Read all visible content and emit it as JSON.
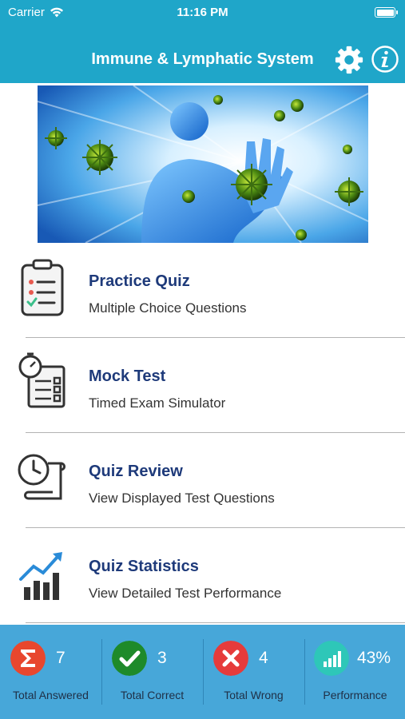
{
  "status_bar": {
    "carrier": "Carrier",
    "time": "11:16 PM"
  },
  "header": {
    "title": "Immune & Lymphatic System",
    "background_color": "#1fa6c9",
    "icons": [
      "gear-icon",
      "info-icon"
    ]
  },
  "hero": {
    "icon": "immune-system-hero-illustration"
  },
  "menu": {
    "items": [
      {
        "label": "Practice Quiz",
        "subtitle": "Multiple Choice Questions",
        "icon": "clipboard-checklist-icon"
      },
      {
        "label": "Mock Test",
        "subtitle": "Timed Exam Simulator",
        "icon": "stopwatch-checklist-icon"
      },
      {
        "label": "Quiz Review",
        "subtitle": "View Displayed Test Questions",
        "icon": "clock-scroll-icon"
      },
      {
        "label": "Quiz Statistics",
        "subtitle": "View Detailed Test Performance",
        "icon": "bar-chart-growth-icon"
      }
    ],
    "title_color": "#1e3a7a"
  },
  "stats": {
    "background_color": "#47a7d9",
    "items": [
      {
        "value": "7",
        "caption": "Total Answered",
        "icon": "sigma-icon",
        "color": "#e8472e"
      },
      {
        "value": "3",
        "caption": "Total Correct",
        "icon": "checkmark-icon",
        "color": "#1e8a2a"
      },
      {
        "value": "4",
        "caption": "Total Wrong",
        "icon": "x-icon",
        "color": "#e63b3b"
      },
      {
        "value": "43%",
        "caption": "Performance",
        "icon": "bar-chart-icon",
        "color": "#2ec7b8"
      }
    ]
  }
}
